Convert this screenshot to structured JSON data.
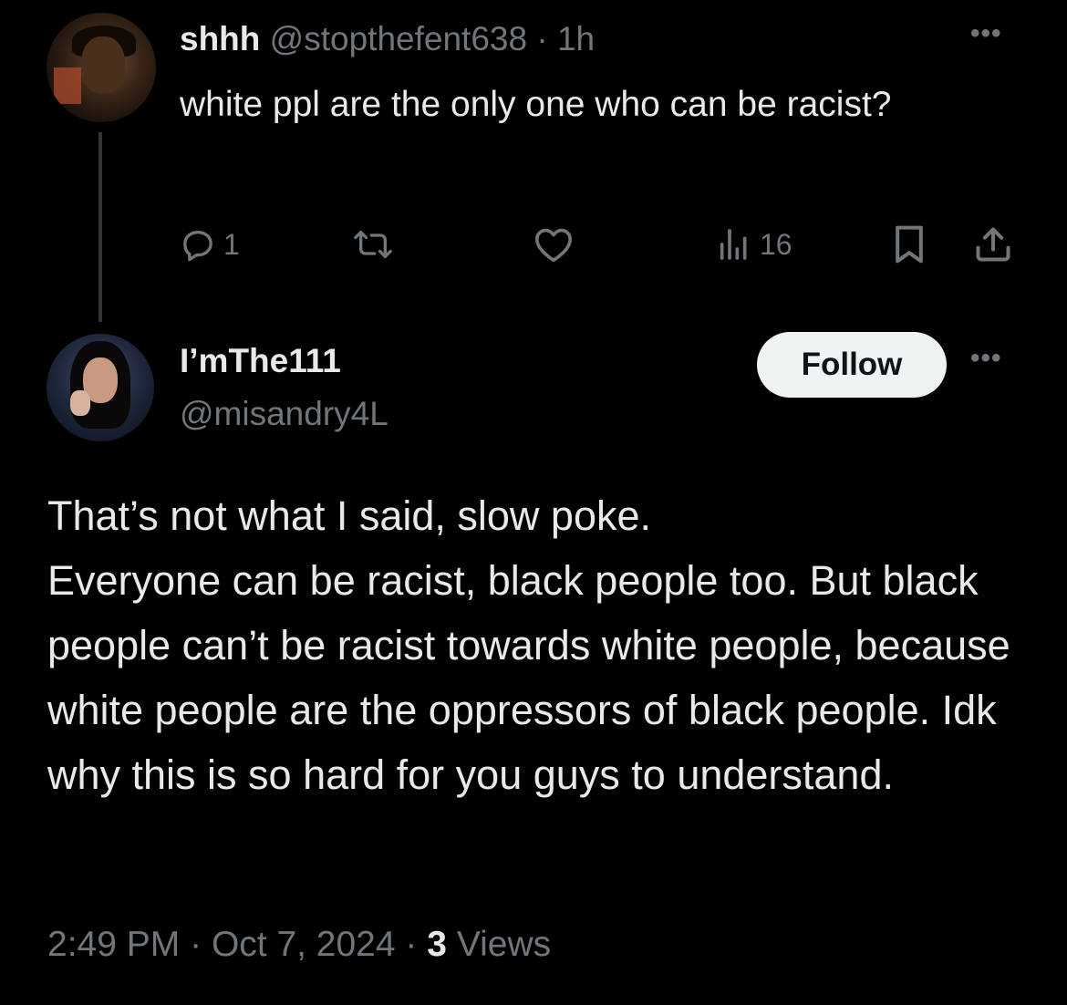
{
  "parent_tweet": {
    "display_name": "shhh",
    "handle": "@stopthefent638",
    "separator": "·",
    "time_ago": "1h",
    "more_label": "•••",
    "text": "white ppl are the only one who can be racist?",
    "actions": {
      "reply_count": "1",
      "retweet_count": "",
      "like_count": "",
      "views_count": "16"
    },
    "icons": [
      "reply-icon",
      "retweet-icon",
      "like-icon",
      "views-icon",
      "bookmark-icon",
      "share-icon"
    ]
  },
  "reply_tweet": {
    "display_name": "I’mThe111",
    "handle": "@misandry4L",
    "follow_label": "Follow",
    "more_label": "•••",
    "lines": [
      "That’s not what I said, slow poke.",
      "Everyone can be racist, black people too. But black people can’t be racist towards white people, because white people are the oppressors of black people. Idk why this is so hard for you guys to understand."
    ],
    "time": "2:49 PM",
    "date": "Oct 7, 2024",
    "separator": "·",
    "views_count": "3",
    "views_label": "Views"
  },
  "colors": {
    "background": "#000000",
    "primary_text": "#e7e9ea",
    "secondary_text": "#71767b",
    "follow_button_bg": "#eff3f4",
    "thread_line": "#333639"
  }
}
